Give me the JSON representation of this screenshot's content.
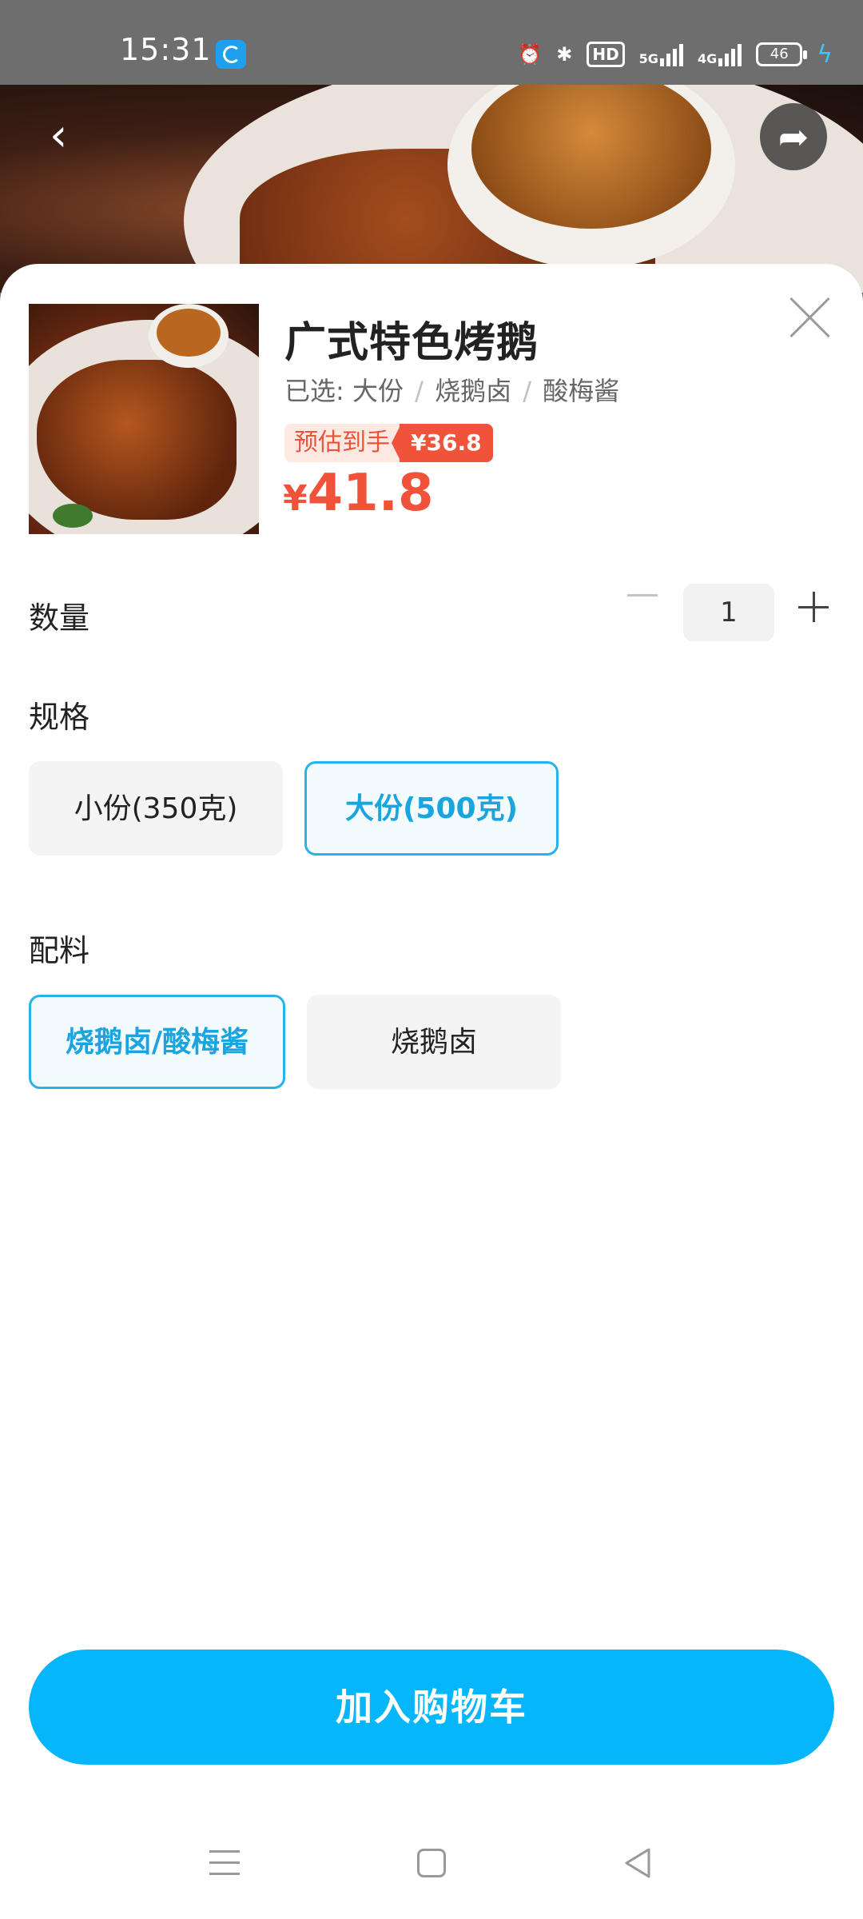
{
  "status_bar": {
    "time": "15:31",
    "hd_label": "HD",
    "net_5g": "5G",
    "net_4g": "4G",
    "battery": "46"
  },
  "product": {
    "title": "广式特色烤鹅",
    "selected_prefix": "已选:",
    "selected_size": "大份",
    "selected_topping_1": "烧鹅卤",
    "selected_topping_2": "酸梅酱",
    "promo_label": "预估到手",
    "promo_price": "¥36.8",
    "price_currency": "¥",
    "price_value": "41.8"
  },
  "quantity": {
    "label": "数量",
    "value": "1"
  },
  "spec": {
    "label": "规格",
    "options": [
      {
        "label": "小份(350克)",
        "selected": false
      },
      {
        "label": "大份(500克)",
        "selected": true
      }
    ]
  },
  "topping": {
    "label": "配料",
    "options": [
      {
        "label": "烧鹅卤/酸梅酱",
        "selected": true
      },
      {
        "label": "烧鹅卤",
        "selected": false
      }
    ]
  },
  "actions": {
    "add_to_cart": "加入购物车"
  },
  "colors": {
    "accent": "#06b6fb",
    "price": "#f0533a",
    "selected_chip_text": "#1aa4e0"
  }
}
